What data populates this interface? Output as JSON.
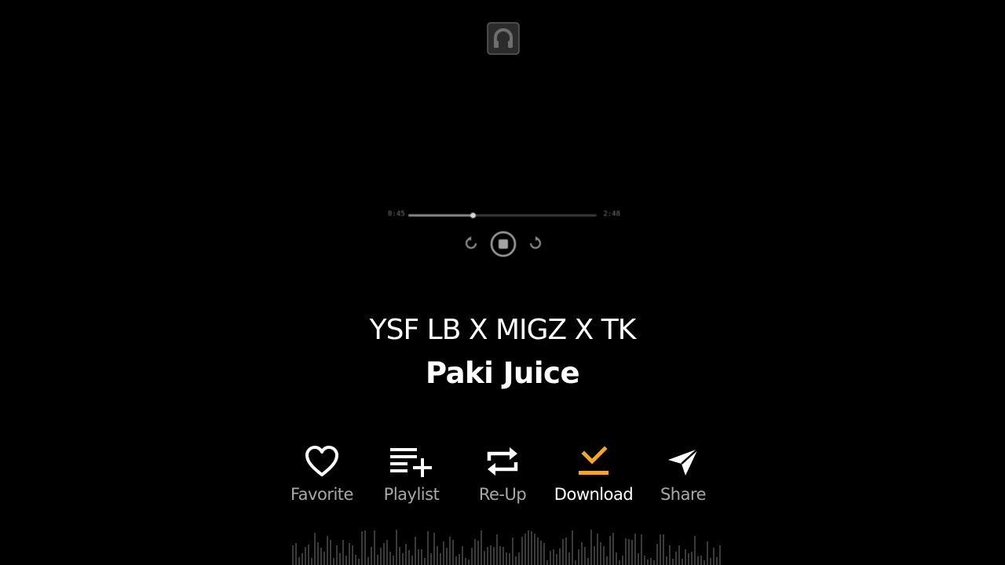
{
  "app": {
    "logo_icon": "headphones-logo-icon"
  },
  "player": {
    "elapsed": "0:45",
    "duration": "2:48",
    "progress": 0.34,
    "prev_icon": "rewind-icon",
    "play_icon": "pause-icon",
    "next_icon": "forward-icon"
  },
  "track": {
    "artist": "YSF LB X MIGZ X TK",
    "title": "Paki Juice"
  },
  "actions": [
    {
      "label": "Favorite",
      "icon": "heart-icon",
      "active": false
    },
    {
      "label": "Playlist",
      "icon": "playlist-add-icon",
      "active": false
    },
    {
      "label": "Re-Up",
      "icon": "repeat-icon",
      "active": false
    },
    {
      "label": "Download",
      "icon": "download-icon",
      "active": true
    },
    {
      "label": "Share",
      "icon": "send-icon",
      "active": false
    }
  ],
  "colors": {
    "background": "#000000",
    "accent": "#f5a623",
    "muted": "#a8a8a8"
  }
}
